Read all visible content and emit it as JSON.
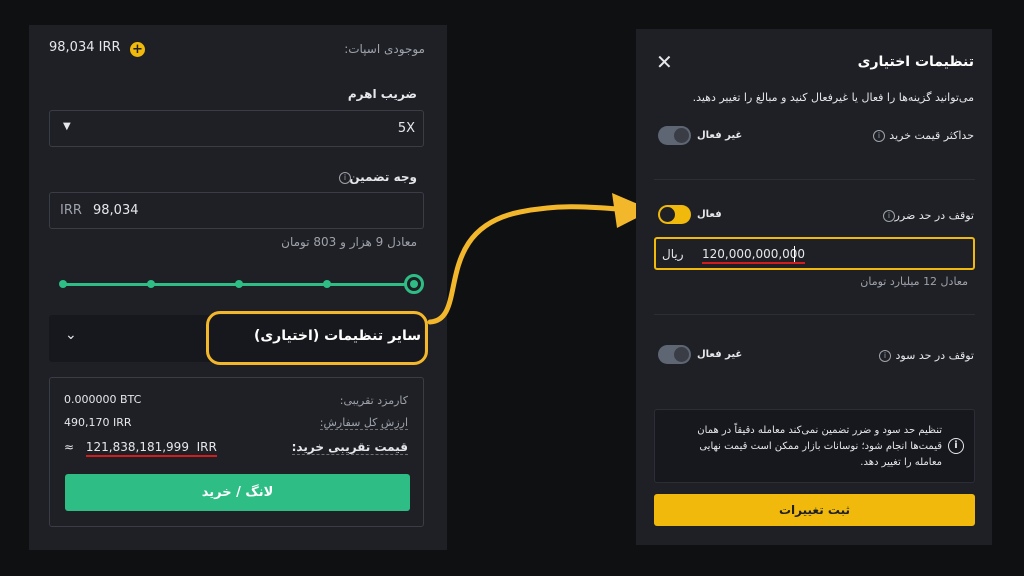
{
  "left": {
    "balance_value": "98,034 IRR",
    "balance_label": "موجودی اسپات:",
    "leverage_label": "ضریب اهرم",
    "leverage_value": "5X",
    "margin_label": "وجه تضمین",
    "margin_currency": "IRR",
    "margin_value": "98,034",
    "margin_equiv": "معادل 9 هزار و 803 تومان",
    "slider_level_percent": 100,
    "advanced_label": "سایر تنظیمات (اختیاری)",
    "summary": {
      "fee_value": "0.000000 BTC",
      "fee_label": "کارمزد تقریبی:",
      "total_value": "490,170 IRR",
      "total_label": "ارزش کل سفارش:",
      "price_approx": "≈",
      "price_value": "121,838,181,999",
      "price_currency": "IRR",
      "price_label": "قیمت تقریبی خرید:"
    },
    "buy_button": "لانگ / خرید"
  },
  "right": {
    "title": "تنظیمات اختیاری",
    "description": "می‌توانید گزینه‌ها را فعال یا غیرفعال کنید و مبالغ را تغییر دهید.",
    "max_price_label": "حداکثر قیمت خرید",
    "max_price_state": "غیر فعال",
    "stop_loss_label": "توقف در حد ضرر",
    "stop_loss_state": "فعال",
    "stop_loss_currency": "ریال",
    "stop_loss_value": "120,000,000,000",
    "stop_loss_equiv": "معادل 12 میلیارد تومان",
    "take_profit_label": "توقف در حد سود",
    "take_profit_state": "غیر فعال",
    "warning": "تنظیم حد سود و ضرر تضمین نمی‌کند معامله دقیقاً در همان قیمت‌ها انجام شود؛ نوسانات بازار ممکن است قیمت نهایی معامله را تغییر دهد.",
    "save_button": "ثبت تغییرات"
  },
  "colors": {
    "accent_yellow": "#f0b90b",
    "accent_green": "#2ebd85",
    "highlight_red": "#d11d1d"
  },
  "icons": [
    "plus-icon",
    "info-icon",
    "chevron-down-icon",
    "close-icon",
    "arrow-icon"
  ]
}
